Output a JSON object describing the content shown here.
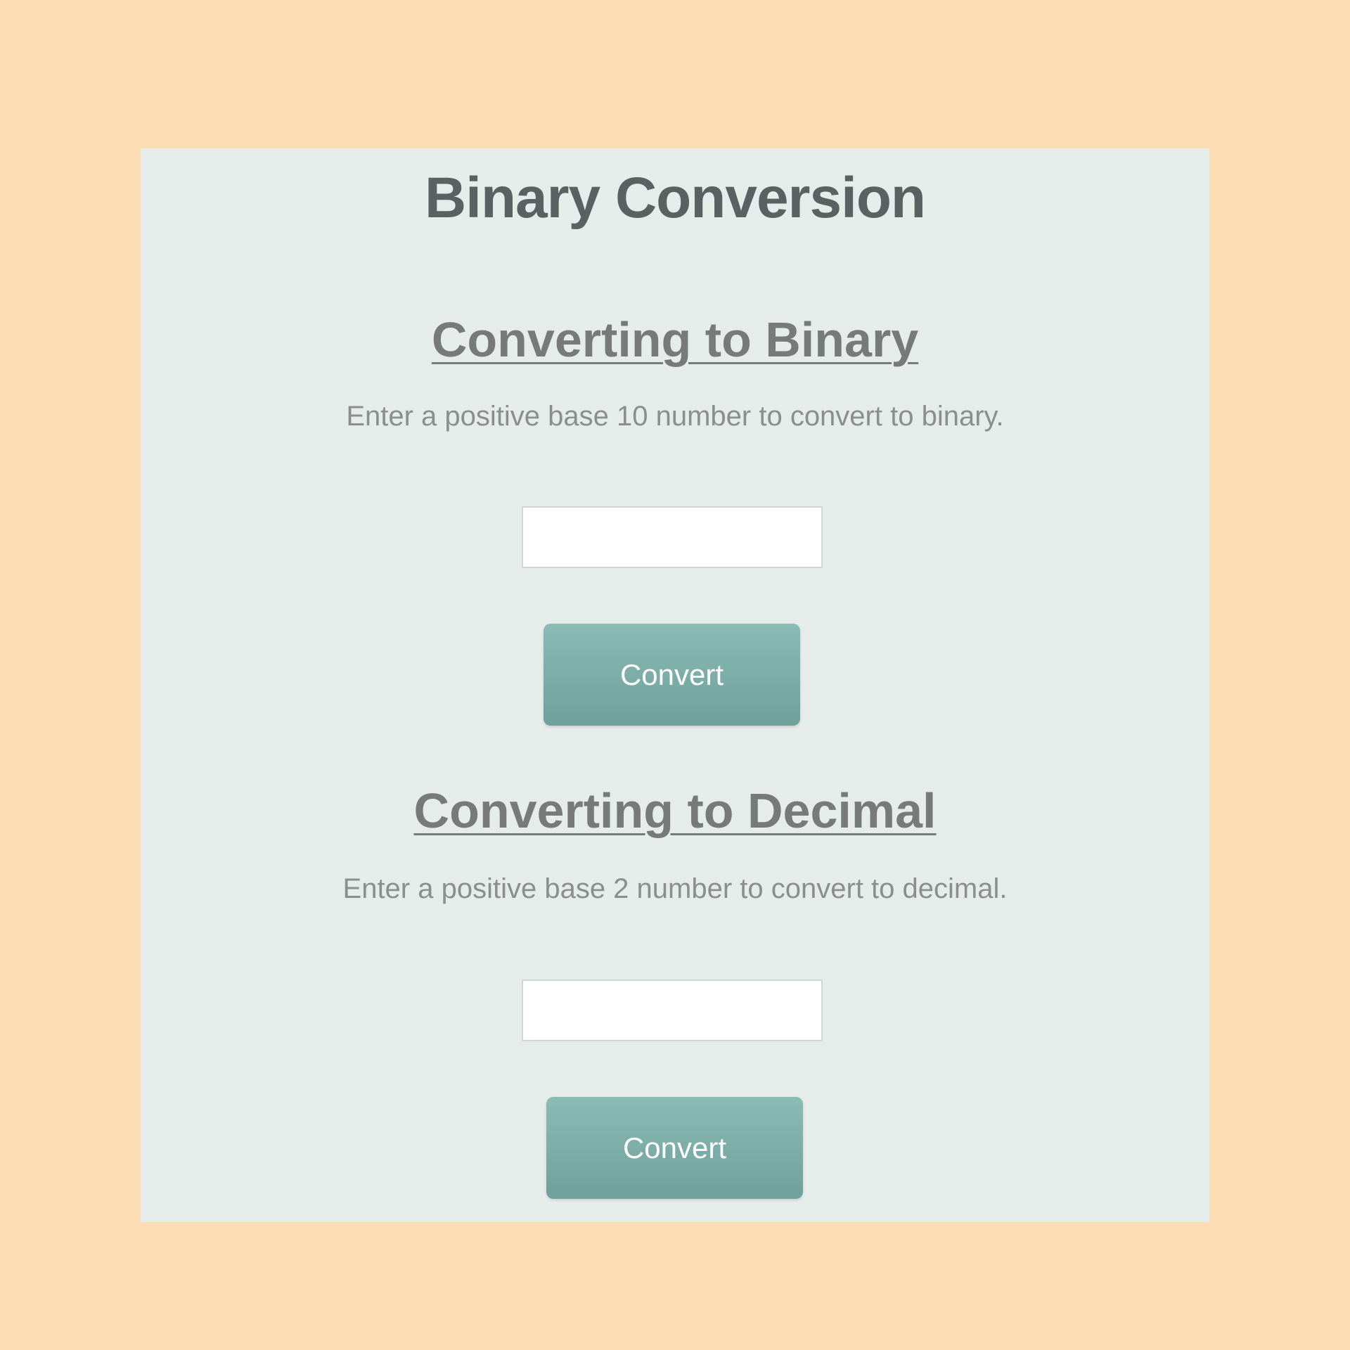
{
  "page": {
    "title": "Binary Conversion"
  },
  "to_binary": {
    "heading": "Converting to Binary",
    "description": "Enter a positive base 10 number to convert to binary.",
    "input_value": "",
    "button_label": "Convert"
  },
  "to_decimal": {
    "heading": "Converting to Decimal",
    "description": "Enter a positive base 2 number to convert to decimal.",
    "input_value": "",
    "button_label": "Convert"
  },
  "colors": {
    "background": "#FDDEB4",
    "panel": "#E5ECEA",
    "button": "#7FAFAA",
    "title_text": "#5B6160",
    "heading_text": "#767B7A",
    "description_text": "#8A8F8E"
  }
}
